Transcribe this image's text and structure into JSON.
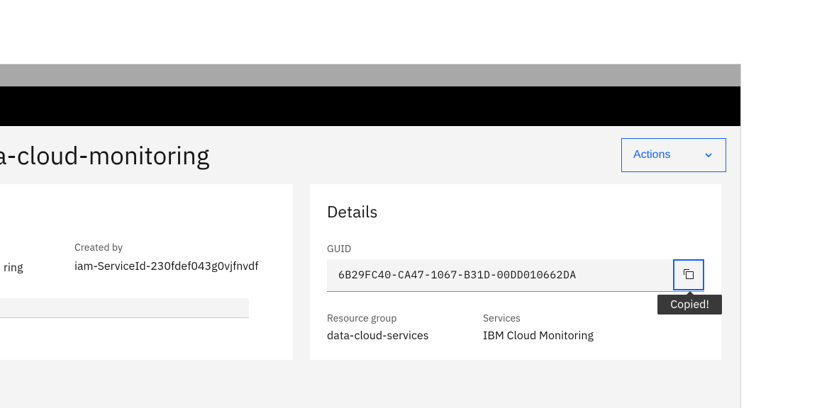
{
  "header": {
    "title": "a-cloud-monitoring",
    "actions_label": "Actions"
  },
  "left": {
    "name_value_fragment": "ring",
    "created_by_label": "Created by",
    "created_by_value": "iam-ServiceId-230fdef043g0vjfnvdf"
  },
  "details": {
    "heading": "Details",
    "guid": {
      "label": "GUID",
      "value": "6B29FC40-CA47-1067-B31D-00DD010662DA",
      "tooltip": "Copied!"
    },
    "resource_group": {
      "label": "Resource group",
      "value": "data-cloud-services"
    },
    "services": {
      "label": "Services",
      "value": "IBM Cloud Monitoring"
    }
  }
}
